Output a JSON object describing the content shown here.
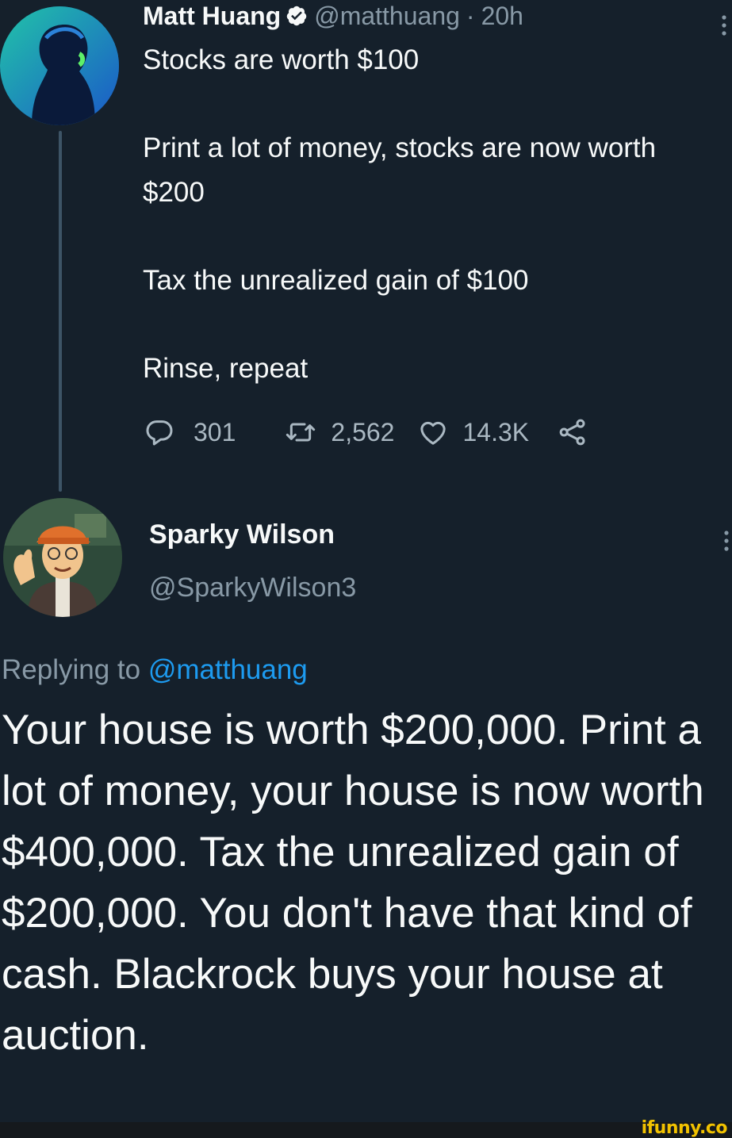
{
  "tweet": {
    "author_name": "Matt Huang",
    "author_handle": "@matthuang",
    "separator": "·",
    "time": "20h",
    "paragraphs": [
      "Stocks are worth $100",
      "Print a lot of money, stocks are now worth $200",
      "Tax the unrealized gain of $100",
      "Rinse, repeat"
    ],
    "stats": {
      "replies": "301",
      "retweets": "2,562",
      "likes": "14.3K"
    },
    "icons": [
      "verified-badge-icon",
      "reply-icon",
      "retweet-icon",
      "like-icon",
      "share-icon",
      "more-icon"
    ]
  },
  "reply": {
    "author_name": "Sparky Wilson",
    "author_handle": "@SparkyWilson3",
    "replying_prefix": "Replying to",
    "replying_mention": "@matthuang",
    "text": "Your house is worth $200,000. Print a lot of money, your house is now worth $400,000.  Tax the unrealized gain of $200,000. You don't have that kind of cash. Blackrock buys your house at auction."
  },
  "watermark": "ifunny.co",
  "colors": {
    "background": "#15202b",
    "text": "#f7f9f9",
    "secondary_text": "#8899a6",
    "link": "#1d9bf0",
    "verified": "#1d9bf0",
    "watermark": "#f2c200"
  }
}
